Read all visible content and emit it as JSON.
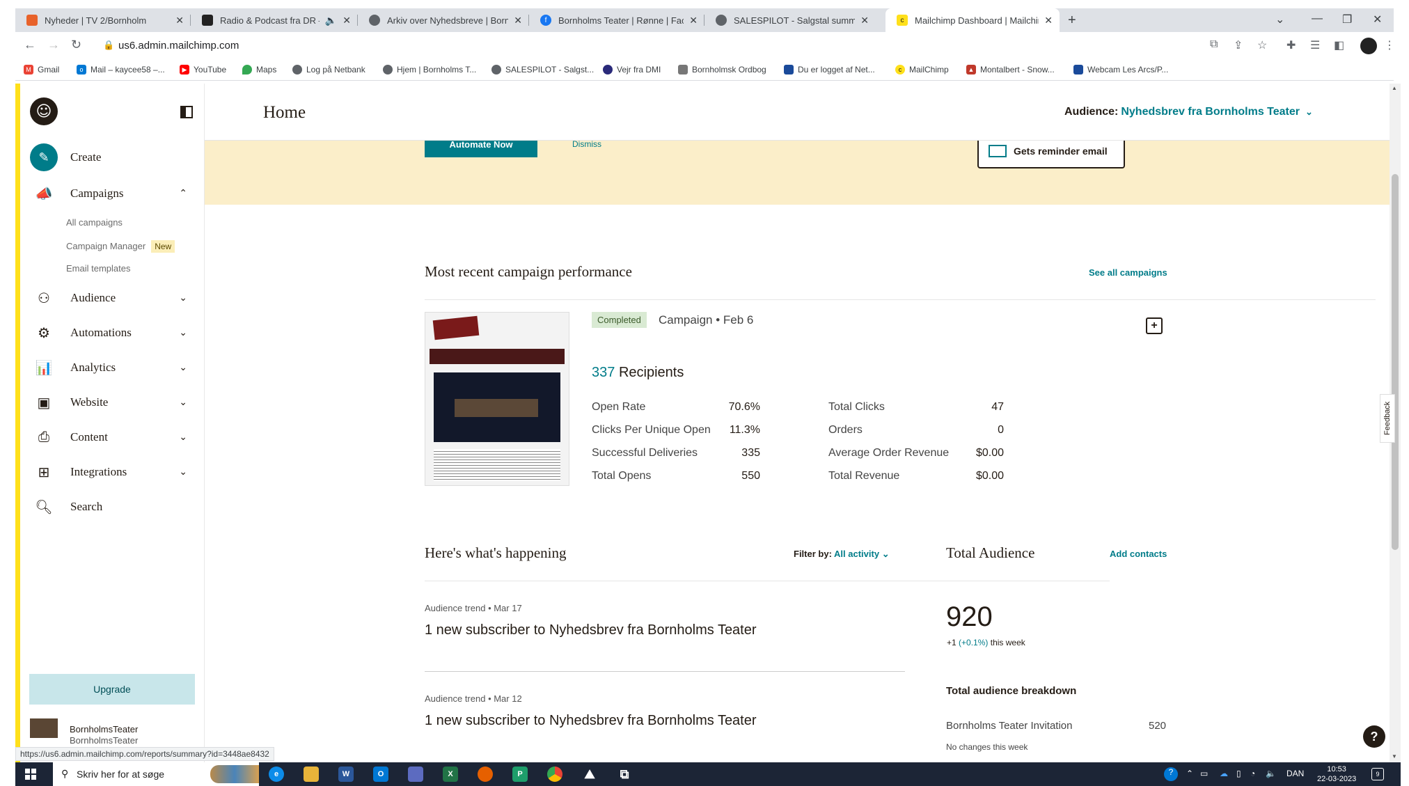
{
  "browser": {
    "tabs": [
      {
        "title": "Nyheder | TV 2/Bornholm",
        "icon": "tv2-favicon",
        "color": "#e8622a"
      },
      {
        "title": "Radio & Podcast fra DR – Hø",
        "icon": "dr-favicon",
        "color": "#222222"
      },
      {
        "title": "Arkiv over Nyhedsbreve | Bornh",
        "icon": "globe-favicon",
        "color": "#5f6368"
      },
      {
        "title": "Bornholms Teater | Rønne | Face",
        "icon": "facebook-favicon",
        "color": "#1877f2"
      },
      {
        "title": "SALESPILOT - Salgstal summeret",
        "icon": "globe-favicon",
        "color": "#5f6368"
      },
      {
        "title": "Mailchimp Dashboard | Mailchim",
        "icon": "mailchimp-favicon",
        "color": "#ffe01b"
      }
    ],
    "url": "us6.admin.mailchimp.com",
    "bookmarks": [
      {
        "label": "Gmail",
        "icon": "gmail-icon",
        "color": "#ea4335"
      },
      {
        "label": "Mail – kaycee58 –...",
        "icon": "outlook-icon",
        "color": "#0078d4"
      },
      {
        "label": "YouTube",
        "icon": "youtube-icon",
        "color": "#ff0000"
      },
      {
        "label": "Maps",
        "icon": "maps-icon",
        "color": "#34a853"
      },
      {
        "label": "Log på Netbank",
        "icon": "globe-icon",
        "color": "#5f6368"
      },
      {
        "label": "Hjem | Bornholms T...",
        "icon": "globe-icon",
        "color": "#5f6368"
      },
      {
        "label": "SALESPILOT - Salgst...",
        "icon": "globe-icon",
        "color": "#5f6368"
      },
      {
        "label": "Vejr fra DMI",
        "icon": "dmi-icon",
        "color": "#2a2a7a"
      },
      {
        "label": "Bornholmsk Ordbog",
        "icon": "book-icon",
        "color": "#777777"
      },
      {
        "label": "Du er logget af Net...",
        "icon": "netbank-icon",
        "color": "#1a4a9a"
      },
      {
        "label": "MailChimp",
        "icon": "mailchimp-icon",
        "color": "#ffe01b"
      },
      {
        "label": "Montalbert - Snow...",
        "icon": "montalbert-icon",
        "color": "#c0392b"
      },
      {
        "label": "Webcam Les Arcs/P...",
        "icon": "webcam-icon",
        "color": "#1a4a9a"
      }
    ],
    "status_url": "https://us6.admin.mailchimp.com/reports/summary?id=3448ae8432"
  },
  "sidebar": {
    "create": "Create",
    "campaigns": "Campaigns",
    "sub_items": [
      "All campaigns",
      "Campaign Manager",
      "Email templates"
    ],
    "new_badge": "New",
    "items": [
      "Audience",
      "Automations",
      "Analytics",
      "Website",
      "Content",
      "Integrations"
    ],
    "search": "Search",
    "upgrade": "Upgrade",
    "account_name": "BornholmsTeater",
    "account_sub": "BornholmsTeater"
  },
  "header": {
    "title": "Home",
    "audience_label": "Audience:",
    "audience_name": "Nyhedsbrev fra Bornholms Teater"
  },
  "banner": {
    "button": "Automate Now",
    "dismiss": "Dismiss",
    "card": "Gets reminder email"
  },
  "campaign": {
    "section_title": "Most recent campaign performance",
    "see_all": "See all campaigns",
    "status": "Completed",
    "label": "Campaign • Feb 6",
    "recipients_count": "337",
    "recipients_label": "Recipients",
    "stats_left": [
      {
        "label": "Open Rate",
        "value": "70.6%"
      },
      {
        "label": "Clicks Per Unique Open",
        "value": "11.3%"
      },
      {
        "label": "Successful Deliveries",
        "value": "335"
      },
      {
        "label": "Total Opens",
        "value": "550"
      }
    ],
    "stats_right": [
      {
        "label": "Total Clicks",
        "value": "47"
      },
      {
        "label": "Orders",
        "value": "0"
      },
      {
        "label": "Average Order Revenue",
        "value": "$0.00"
      },
      {
        "label": "Total Revenue",
        "value": "$0.00"
      }
    ]
  },
  "happening": {
    "title": "Here's what's happening",
    "filter_label": "Filter by:",
    "filter_value": "All activity",
    "items": [
      {
        "meta": "Audience trend  • Mar 17",
        "text": "1 new subscriber to Nyhedsbrev fra Bornholms Teater"
      },
      {
        "meta": "Audience trend  • Mar 12",
        "text": "1 new subscriber to Nyhedsbrev fra Bornholms Teater"
      }
    ]
  },
  "audience_panel": {
    "title": "Total Audience",
    "add_contacts": "Add contacts",
    "total": "920",
    "change_prefix": "+1",
    "change_pct": "(+0.1%)",
    "change_suffix": "this week",
    "breakdown_title": "Total audience breakdown",
    "breakdown_name": "Bornholms Teater Invitation",
    "breakdown_value": "520",
    "breakdown_sub": "No changes this week"
  },
  "misc": {
    "feedback": "Feedback",
    "help": "?"
  },
  "taskbar": {
    "search_placeholder": "Skriv her for at søge",
    "language": "DAN",
    "time": "10:53",
    "date": "22-03-2023",
    "notifications": "9"
  }
}
